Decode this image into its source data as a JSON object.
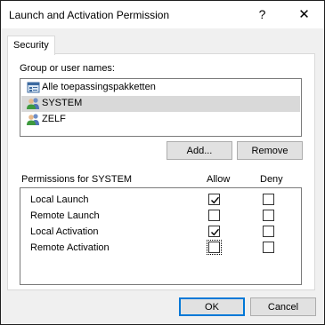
{
  "window": {
    "title": "Launch and Activation Permission",
    "help_glyph": "?",
    "close_glyph": "✕"
  },
  "tab": {
    "label": "Security"
  },
  "group": {
    "label": "Group or user names:",
    "users": [
      {
        "name": "Alle toepassingspakketten",
        "icon": "app-packages-icon",
        "selected": false
      },
      {
        "name": "SYSTEM",
        "icon": "users-icon",
        "selected": true
      },
      {
        "name": "ZELF",
        "icon": "users-icon",
        "selected": false
      }
    ]
  },
  "buttons": {
    "add": "Add...",
    "remove": "Remove",
    "ok": "OK",
    "cancel": "Cancel"
  },
  "permissions": {
    "header": "Permissions for SYSTEM",
    "allow_label": "Allow",
    "deny_label": "Deny",
    "rows": [
      {
        "label": "Local Launch",
        "allow": true,
        "deny": false
      },
      {
        "label": "Remote Launch",
        "allow": false,
        "deny": false
      },
      {
        "label": "Local Activation",
        "allow": true,
        "deny": false
      },
      {
        "label": "Remote Activation",
        "allow": false,
        "deny": false
      }
    ]
  }
}
